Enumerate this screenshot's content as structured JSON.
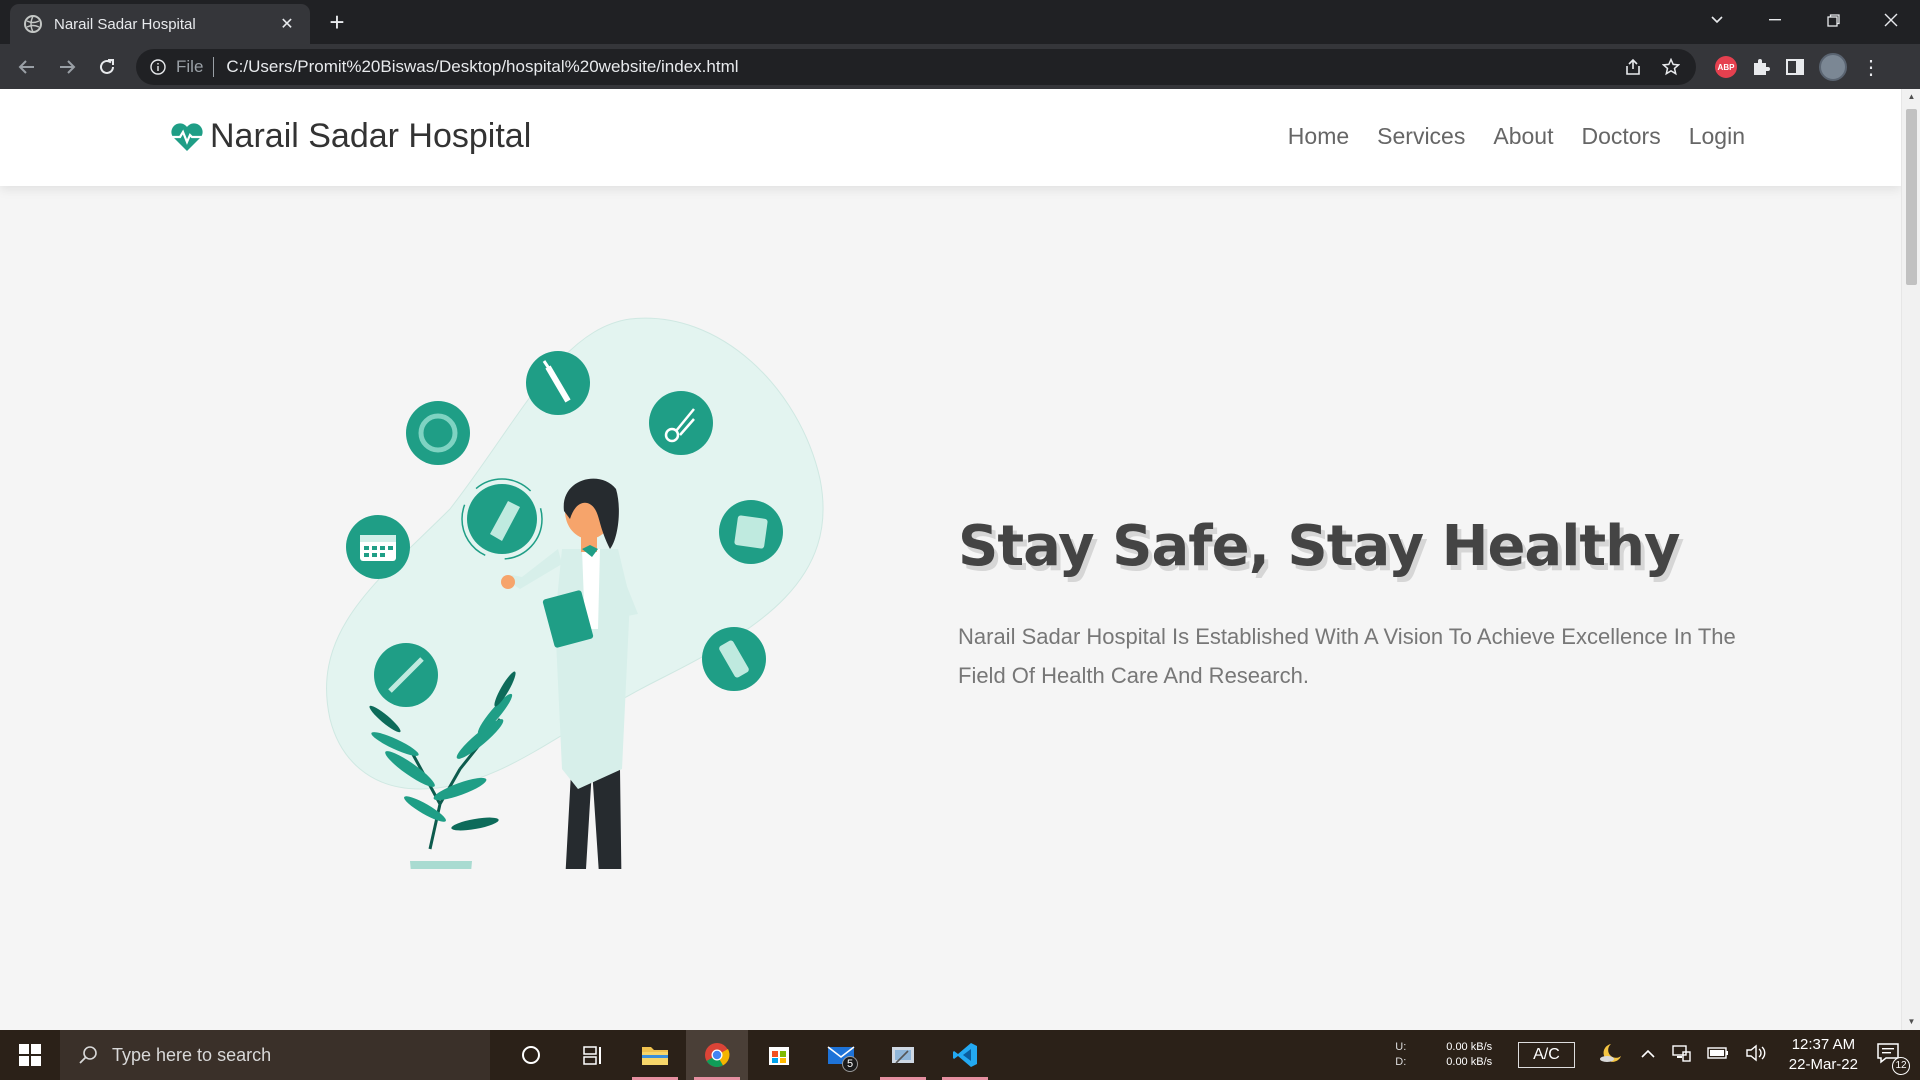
{
  "browser": {
    "tab_title": "Narail Sadar Hospital",
    "tab_close": "✕",
    "new_tab": "+",
    "url_scheme": "File",
    "url": "C:/Users/Promit%20Biswas/Desktop/hospital%20website/index.html",
    "abp_label": "ABP"
  },
  "site": {
    "logo_text": "Narail Sadar Hospital",
    "nav": [
      "Home",
      "Services",
      "About",
      "Doctors",
      "Login"
    ],
    "hero_title": "Stay Safe, Stay Healthy",
    "hero_desc": "Narail Sadar Hospital Is Established With A Vision To Achieve Excellence In The Field Of Health Care And Research."
  },
  "taskbar": {
    "search_placeholder": "Type here to search",
    "mail_badge": "5",
    "net_up_label": "U:",
    "net_down_label": "D:",
    "net_up": "0.00 kB/s",
    "net_down": "0.00 kB/s",
    "ac_label": "A/C",
    "time": "12:37 AM",
    "date": "22-Mar-22",
    "notifications": "12"
  },
  "colors": {
    "accent": "#1f9e86",
    "accent_light": "#e3f4f0"
  }
}
